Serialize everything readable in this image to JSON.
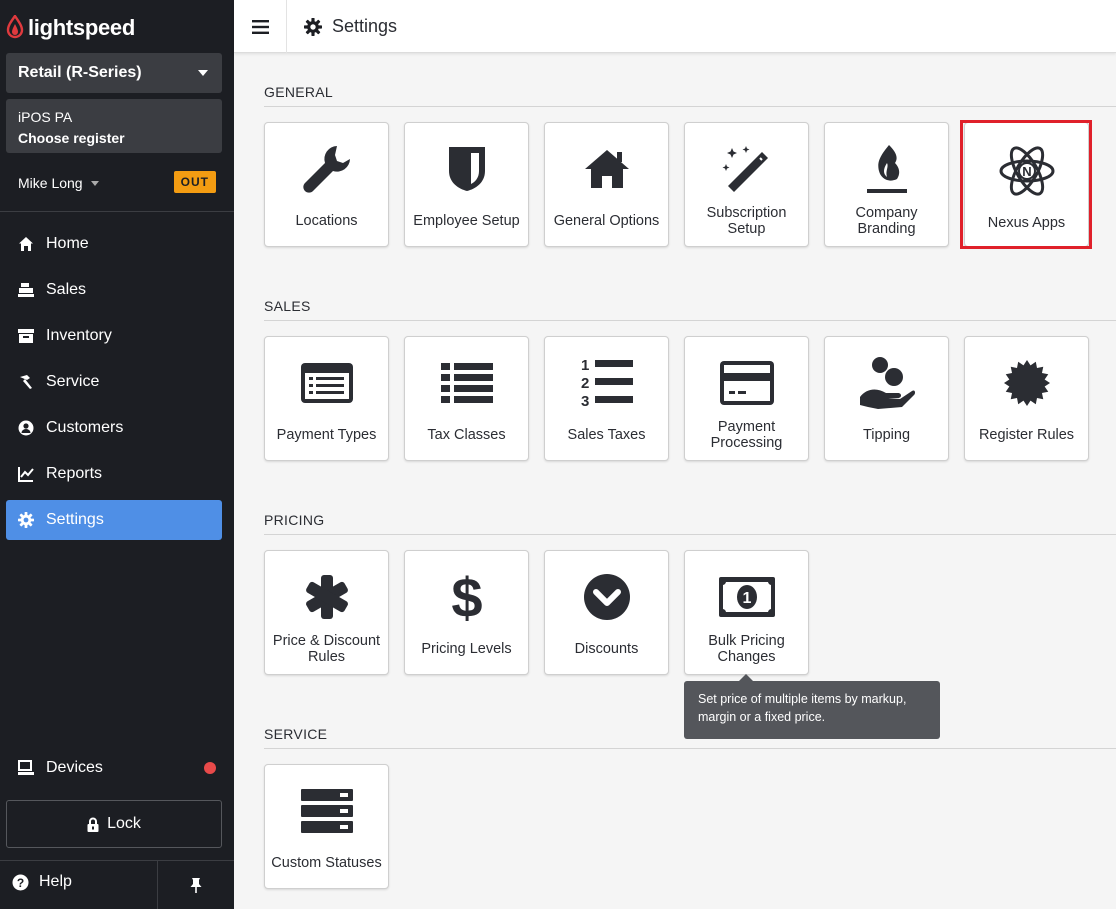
{
  "brand": {
    "name": "lightspeed",
    "accent": "#e03a3e"
  },
  "sidebar": {
    "store_select": "Retail (R-Series)",
    "register_line1": "iPOS PA",
    "register_line2": "Choose register",
    "user_name": "Mike Long",
    "status_badge": "OUT",
    "items": [
      {
        "label": "Home",
        "icon": "home-icon"
      },
      {
        "label": "Sales",
        "icon": "register-icon"
      },
      {
        "label": "Inventory",
        "icon": "inventory-icon"
      },
      {
        "label": "Service",
        "icon": "hammer-icon"
      },
      {
        "label": "Customers",
        "icon": "person-icon"
      },
      {
        "label": "Reports",
        "icon": "chart-icon"
      },
      {
        "label": "Settings",
        "icon": "gear-icon",
        "active": true
      }
    ],
    "devices_label": "Devices",
    "lock_label": "Lock",
    "help_label": "Help"
  },
  "header": {
    "title": "Settings"
  },
  "sections": {
    "general": {
      "title": "GENERAL",
      "tiles": [
        "Locations",
        "Employee Setup",
        "General Options",
        "Subscription Setup",
        "Company Branding",
        "Nexus Apps"
      ]
    },
    "sales": {
      "title": "SALES",
      "tiles": [
        "Payment Types",
        "Tax Classes",
        "Sales Taxes",
        "Payment Processing",
        "Tipping",
        "Register Rules"
      ]
    },
    "pricing": {
      "title": "PRICING",
      "tiles": [
        "Price & Discount Rules",
        "Pricing Levels",
        "Discounts",
        "Bulk Pricing Changes"
      ]
    },
    "service": {
      "title": "SERVICE",
      "tiles": [
        "Custom Statuses"
      ]
    }
  },
  "tooltip": {
    "text": "Set price of multiple items by markup, margin or a fixed price."
  }
}
